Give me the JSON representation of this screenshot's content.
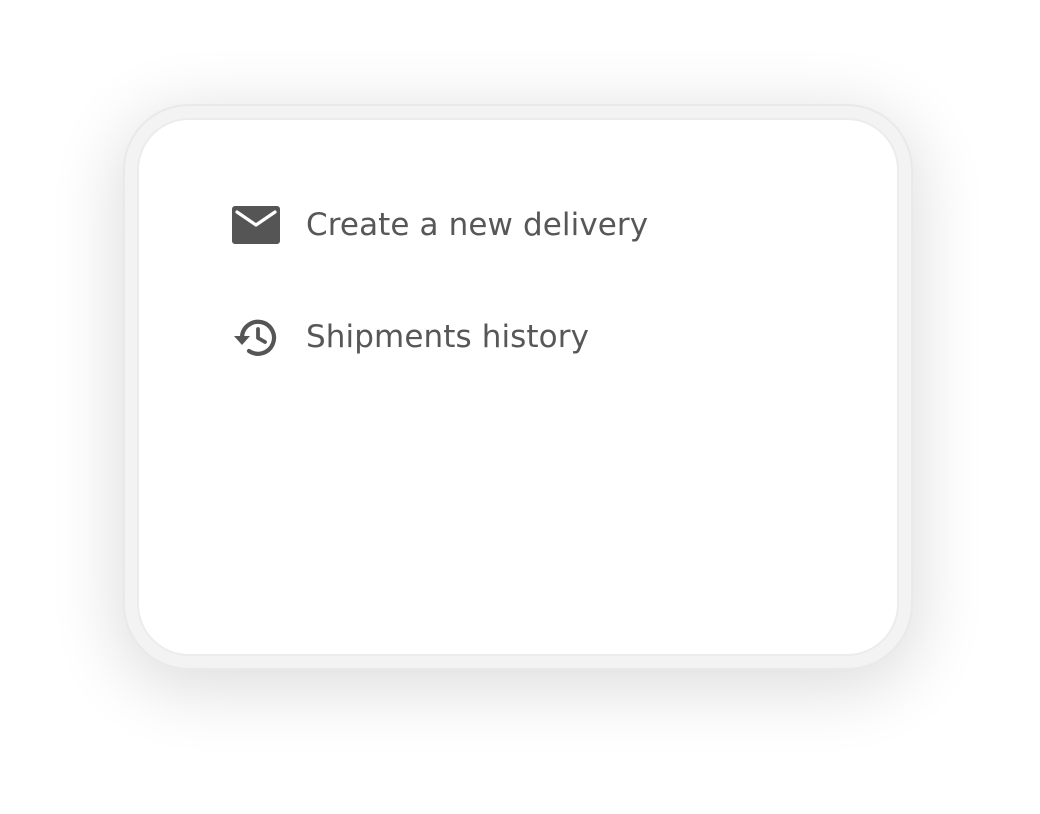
{
  "menu": {
    "items": [
      {
        "label": "Create a new delivery",
        "icon": "mail-icon"
      },
      {
        "label": "Shipments history",
        "icon": "history-icon"
      }
    ]
  },
  "colors": {
    "text": "#575757",
    "icon": "#555555",
    "card_background": "#ffffff",
    "card_border": "#ececec"
  }
}
